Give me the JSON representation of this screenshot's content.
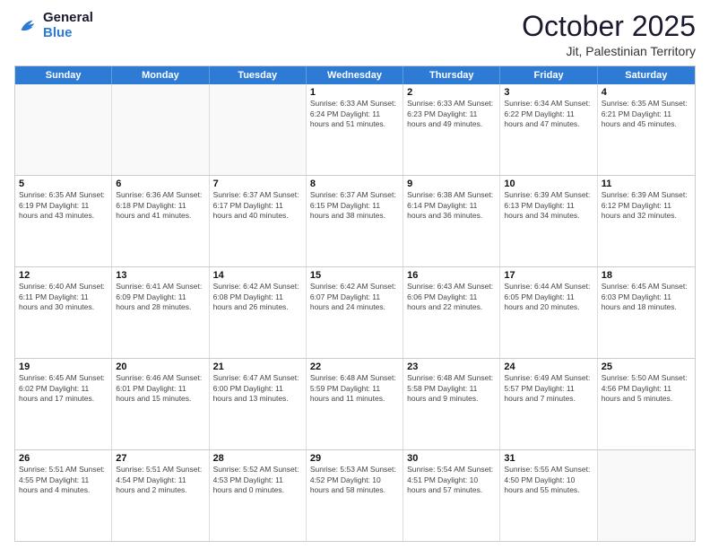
{
  "header": {
    "logo_general": "General",
    "logo_blue": "Blue",
    "title": "October 2025",
    "subtitle": "Jit, Palestinian Territory"
  },
  "days_of_week": [
    "Sunday",
    "Monday",
    "Tuesday",
    "Wednesday",
    "Thursday",
    "Friday",
    "Saturday"
  ],
  "weeks": [
    [
      {
        "day": "",
        "info": ""
      },
      {
        "day": "",
        "info": ""
      },
      {
        "day": "",
        "info": ""
      },
      {
        "day": "1",
        "info": "Sunrise: 6:33 AM\nSunset: 6:24 PM\nDaylight: 11 hours\nand 51 minutes."
      },
      {
        "day": "2",
        "info": "Sunrise: 6:33 AM\nSunset: 6:23 PM\nDaylight: 11 hours\nand 49 minutes."
      },
      {
        "day": "3",
        "info": "Sunrise: 6:34 AM\nSunset: 6:22 PM\nDaylight: 11 hours\nand 47 minutes."
      },
      {
        "day": "4",
        "info": "Sunrise: 6:35 AM\nSunset: 6:21 PM\nDaylight: 11 hours\nand 45 minutes."
      }
    ],
    [
      {
        "day": "5",
        "info": "Sunrise: 6:35 AM\nSunset: 6:19 PM\nDaylight: 11 hours\nand 43 minutes."
      },
      {
        "day": "6",
        "info": "Sunrise: 6:36 AM\nSunset: 6:18 PM\nDaylight: 11 hours\nand 41 minutes."
      },
      {
        "day": "7",
        "info": "Sunrise: 6:37 AM\nSunset: 6:17 PM\nDaylight: 11 hours\nand 40 minutes."
      },
      {
        "day": "8",
        "info": "Sunrise: 6:37 AM\nSunset: 6:15 PM\nDaylight: 11 hours\nand 38 minutes."
      },
      {
        "day": "9",
        "info": "Sunrise: 6:38 AM\nSunset: 6:14 PM\nDaylight: 11 hours\nand 36 minutes."
      },
      {
        "day": "10",
        "info": "Sunrise: 6:39 AM\nSunset: 6:13 PM\nDaylight: 11 hours\nand 34 minutes."
      },
      {
        "day": "11",
        "info": "Sunrise: 6:39 AM\nSunset: 6:12 PM\nDaylight: 11 hours\nand 32 minutes."
      }
    ],
    [
      {
        "day": "12",
        "info": "Sunrise: 6:40 AM\nSunset: 6:11 PM\nDaylight: 11 hours\nand 30 minutes."
      },
      {
        "day": "13",
        "info": "Sunrise: 6:41 AM\nSunset: 6:09 PM\nDaylight: 11 hours\nand 28 minutes."
      },
      {
        "day": "14",
        "info": "Sunrise: 6:42 AM\nSunset: 6:08 PM\nDaylight: 11 hours\nand 26 minutes."
      },
      {
        "day": "15",
        "info": "Sunrise: 6:42 AM\nSunset: 6:07 PM\nDaylight: 11 hours\nand 24 minutes."
      },
      {
        "day": "16",
        "info": "Sunrise: 6:43 AM\nSunset: 6:06 PM\nDaylight: 11 hours\nand 22 minutes."
      },
      {
        "day": "17",
        "info": "Sunrise: 6:44 AM\nSunset: 6:05 PM\nDaylight: 11 hours\nand 20 minutes."
      },
      {
        "day": "18",
        "info": "Sunrise: 6:45 AM\nSunset: 6:03 PM\nDaylight: 11 hours\nand 18 minutes."
      }
    ],
    [
      {
        "day": "19",
        "info": "Sunrise: 6:45 AM\nSunset: 6:02 PM\nDaylight: 11 hours\nand 17 minutes."
      },
      {
        "day": "20",
        "info": "Sunrise: 6:46 AM\nSunset: 6:01 PM\nDaylight: 11 hours\nand 15 minutes."
      },
      {
        "day": "21",
        "info": "Sunrise: 6:47 AM\nSunset: 6:00 PM\nDaylight: 11 hours\nand 13 minutes."
      },
      {
        "day": "22",
        "info": "Sunrise: 6:48 AM\nSunset: 5:59 PM\nDaylight: 11 hours\nand 11 minutes."
      },
      {
        "day": "23",
        "info": "Sunrise: 6:48 AM\nSunset: 5:58 PM\nDaylight: 11 hours\nand 9 minutes."
      },
      {
        "day": "24",
        "info": "Sunrise: 6:49 AM\nSunset: 5:57 PM\nDaylight: 11 hours\nand 7 minutes."
      },
      {
        "day": "25",
        "info": "Sunrise: 5:50 AM\nSunset: 4:56 PM\nDaylight: 11 hours\nand 5 minutes."
      }
    ],
    [
      {
        "day": "26",
        "info": "Sunrise: 5:51 AM\nSunset: 4:55 PM\nDaylight: 11 hours\nand 4 minutes."
      },
      {
        "day": "27",
        "info": "Sunrise: 5:51 AM\nSunset: 4:54 PM\nDaylight: 11 hours\nand 2 minutes."
      },
      {
        "day": "28",
        "info": "Sunrise: 5:52 AM\nSunset: 4:53 PM\nDaylight: 11 hours\nand 0 minutes."
      },
      {
        "day": "29",
        "info": "Sunrise: 5:53 AM\nSunset: 4:52 PM\nDaylight: 10 hours\nand 58 minutes."
      },
      {
        "day": "30",
        "info": "Sunrise: 5:54 AM\nSunset: 4:51 PM\nDaylight: 10 hours\nand 57 minutes."
      },
      {
        "day": "31",
        "info": "Sunrise: 5:55 AM\nSunset: 4:50 PM\nDaylight: 10 hours\nand 55 minutes."
      },
      {
        "day": "",
        "info": ""
      }
    ]
  ]
}
